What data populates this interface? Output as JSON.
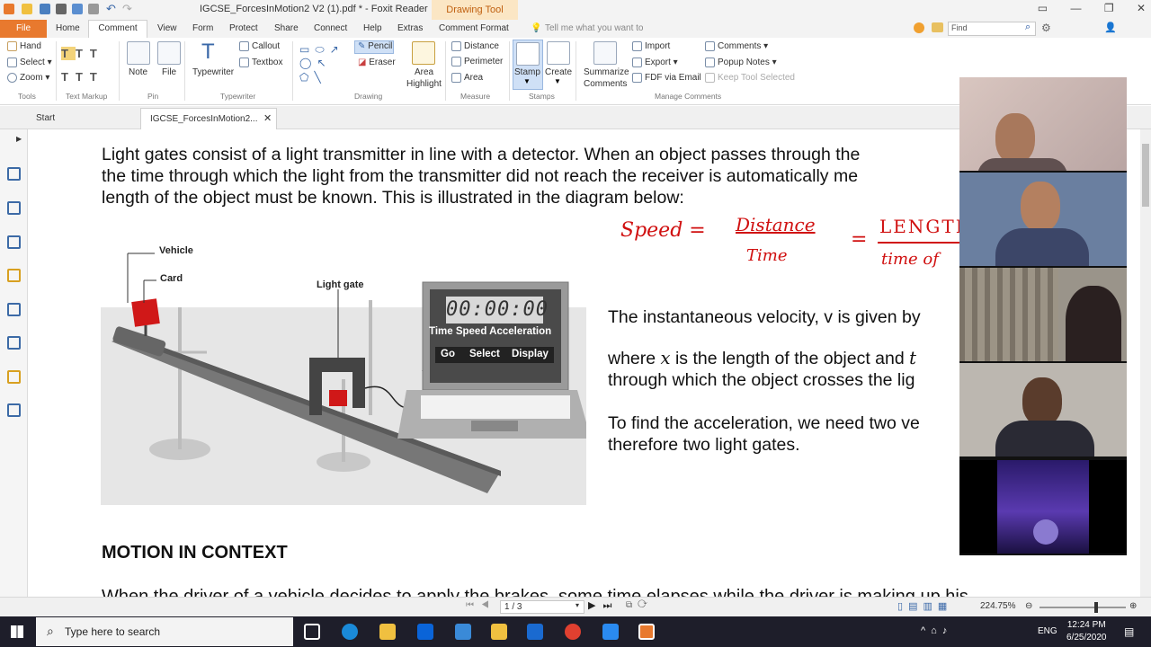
{
  "window": {
    "title": "IGCSE_ForcesInMotion2 V2 (1).pdf * - Foxit Reader",
    "context_tab": "Drawing Tool",
    "accent": "#e8792e"
  },
  "menu": {
    "tabs": [
      "File",
      "Home",
      "Comment",
      "View",
      "Form",
      "Protect",
      "Share",
      "Connect",
      "Help",
      "Extras",
      "Comment Format"
    ],
    "tell_me": "Tell me what you want to",
    "find_placeholder": "Find"
  },
  "ribbon": {
    "hand": "Hand",
    "select": "Select",
    "zoom": "Zoom",
    "tools_group": "Tools",
    "text_markup_group": "Text Markup",
    "note": "Note",
    "file": "File",
    "pin_group": "Pin",
    "typewriter": "Typewriter",
    "callout": "Callout",
    "textbox": "Textbox",
    "typewriter_group": "Typewriter",
    "pencil": "Pencil",
    "eraser": "Eraser",
    "area_highlight_1": "Area",
    "area_highlight_2": "Highlight",
    "drawing_group": "Drawing",
    "distance": "Distance",
    "perimeter": "Perimeter",
    "area": "Area",
    "measure_group": "Measure",
    "stamp": "Stamp",
    "create": "Create",
    "stamps_group": "Stamps",
    "summarize_1": "Summarize",
    "summarize_2": "Comments",
    "import": "Import",
    "export": "Export",
    "fdf": "FDF via Email",
    "comments": "Comments",
    "popup_notes": "Popup Notes",
    "keep_tool": "Keep Tool Selected",
    "manage_group": "Manage Comments"
  },
  "tabs": {
    "start": "Start",
    "doc": "IGCSE_ForcesInMotion2..."
  },
  "document": {
    "para1_line1": "Light gates consist of a light transmitter in line with a detector. When an object passes through the",
    "para1_line2": "the time through which the light from the transmitter did not reach the receiver is automatically me",
    "para1_line3": "length of the object must be known. This is illustrated in the diagram below:",
    "velocity_line": "The instantaneous velocity, v is given by",
    "where_line1_a": "where ",
    "where_line1_x": "x",
    "where_line1_b": " is the length of the object and ",
    "where_line1_t": "t",
    "where_line2": "through which the object crosses the lig",
    "accel_line1": "To find the acceleration, we need two ve",
    "accel_line2": "therefore two light gates.",
    "heading": "MOTION IN CONTEXT",
    "cut_line": "When the driver of a vehicle decides to apply the brakes, some time elapses while the driver is making up his"
  },
  "diagram": {
    "vehicle": "Vehicle",
    "card": "Card",
    "light_gate": "Light gate",
    "timer": "00:00:00",
    "modes": [
      "Time",
      "Speed",
      "Acceleration"
    ],
    "buttons": [
      "Go",
      "Select",
      "Display"
    ]
  },
  "handwriting": {
    "speed": "Speed =",
    "distance": "Distance",
    "time": "Time",
    "equals": "=",
    "length": "LENGTH",
    "time_of": "time of"
  },
  "status": {
    "page": "1 / 3",
    "zoom": "224.75%"
  },
  "taskbar": {
    "search": "Type here to search",
    "lang": "ENG",
    "time": "12:24 PM",
    "date": "6/25/2020"
  }
}
